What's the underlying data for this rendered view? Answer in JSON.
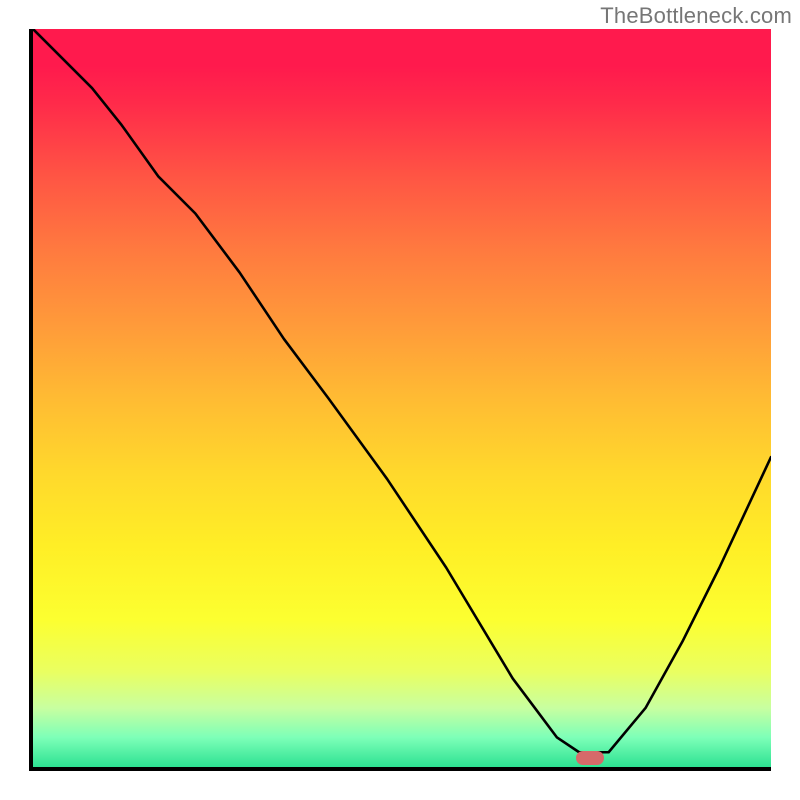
{
  "watermark_text": "TheBottleneck.com",
  "chart_data": {
    "type": "line",
    "title": "",
    "xlabel": "",
    "ylabel": "",
    "xlim": [
      0,
      100
    ],
    "ylim": [
      0,
      100
    ],
    "x": [
      0,
      8,
      12,
      17,
      22,
      28,
      34,
      40,
      48,
      56,
      62,
      65,
      68,
      71,
      74,
      78,
      83,
      88,
      93,
      100
    ],
    "values": [
      100,
      92,
      87,
      80,
      75,
      67,
      58,
      50,
      39,
      27,
      17,
      12,
      8,
      4,
      2,
      2,
      8,
      17,
      27,
      42
    ],
    "marker": {
      "x": 75.5,
      "y": 1.2
    },
    "gradient_semantics": "top=bad (red), bottom=good (green)"
  }
}
